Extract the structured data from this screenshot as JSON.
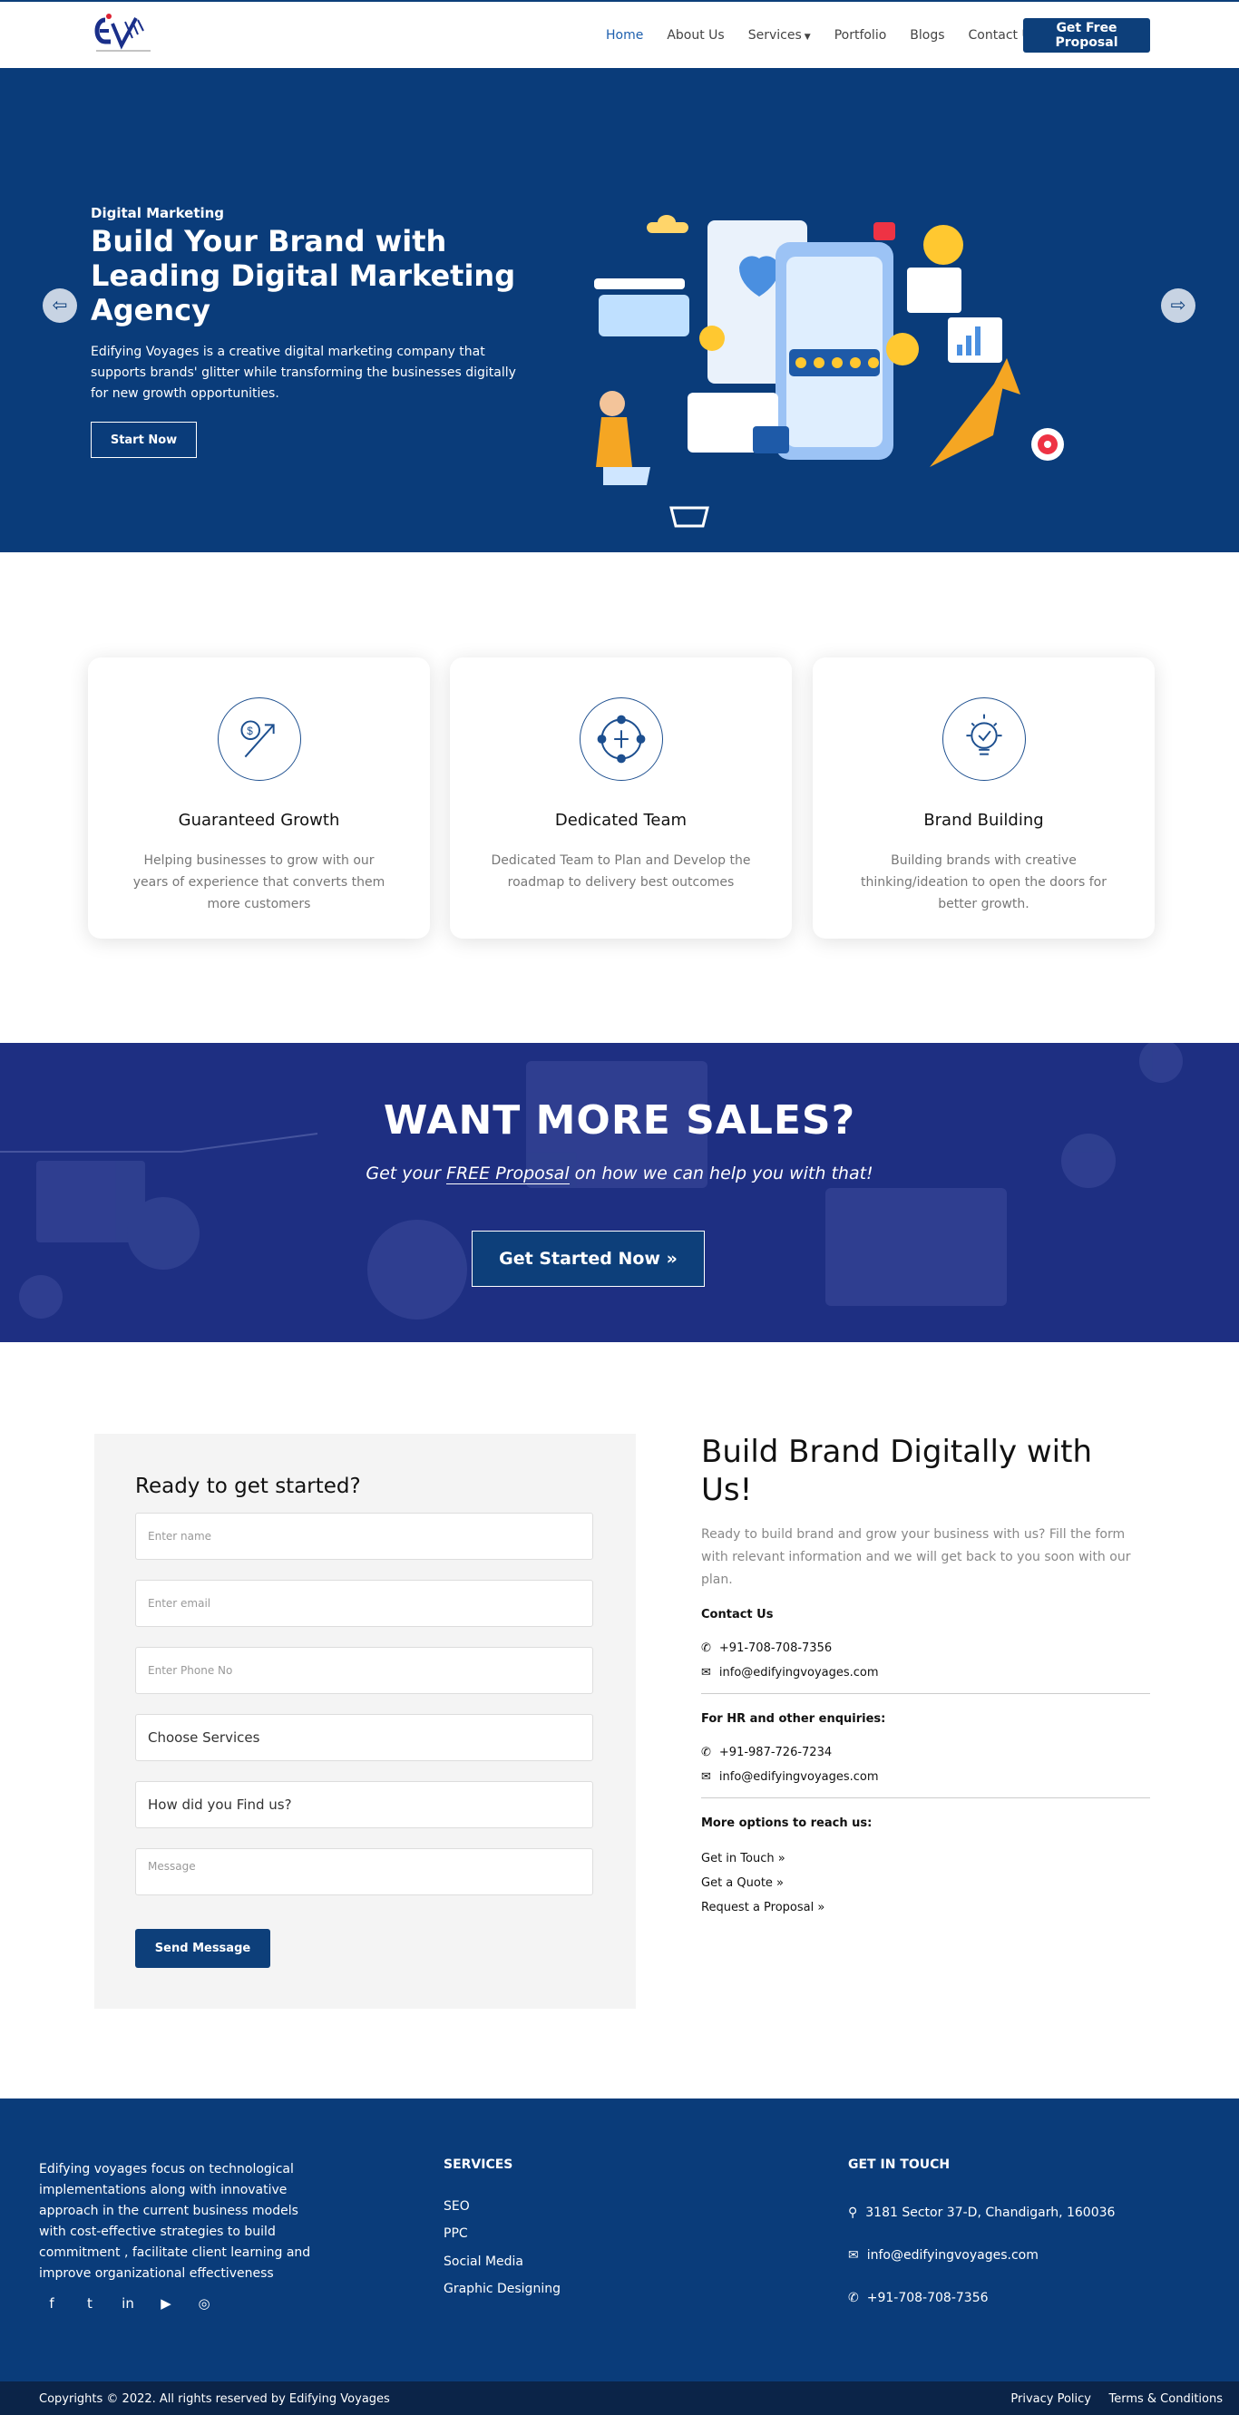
{
  "brand": {
    "logo_icon": "ev-logo-icon",
    "primary": "#0a3c7a",
    "cta_bg": "#1e2f82"
  },
  "nav": {
    "items": [
      {
        "label": "Home",
        "active": true
      },
      {
        "label": "About Us"
      },
      {
        "label": "Services"
      },
      {
        "label": "Portfolio"
      },
      {
        "label": "Blogs"
      },
      {
        "label": "Contact Us"
      }
    ],
    "cta": "Get Free Proposal"
  },
  "hero": {
    "eyebrow": "Digital Marketing",
    "title": "Build Your Brand with Leading Digital Marketing Agency",
    "text": "Edifying Voyages is a creative digital marketing company that supports brands' glitter while transforming the businesses digitally for new growth opportunities.",
    "button": "Start Now",
    "prev_icon": "arrow-left-icon",
    "next_icon": "arrow-right-icon"
  },
  "features": [
    {
      "title": "Guaranteed Growth",
      "text": "Helping businesses to grow with our years of experience that converts them more customers",
      "icon": "growth-icon"
    },
    {
      "title": "Dedicated Team",
      "text": "Dedicated Team to Plan and Develop the roadmap to delivery best outcomes",
      "icon": "team-icon"
    },
    {
      "title": "Brand Building",
      "text": "Building brands with creative thinking/ideation to open the doors for better growth.",
      "icon": "lightbulb-icon"
    }
  ],
  "cta": {
    "title": "WANT MORE SALES?",
    "sub_pre": "Get your ",
    "sub_link": "FREE Proposal",
    "sub_post": " on how we can help you with that!",
    "button": "Get Started Now »"
  },
  "form": {
    "title": "Ready to get started?",
    "name_ph": "Enter name",
    "email_ph": "Enter email",
    "phone_ph": "Enter Phone No",
    "services": "Choose Services",
    "found": "How did you Find us?",
    "message_ph": "Message",
    "submit": "Send Message"
  },
  "contact": {
    "title": "Build Brand Digitally with Us!",
    "lead": "Ready to build brand and grow your business with us? Fill the form with relevant information and we will get back to you soon with our plan.",
    "contact_heading": "Contact Us",
    "phone1": "+91-708-708-7356",
    "email1": "info@edifyingvoyages.com",
    "hr_heading": "For HR and other enquiries:",
    "phone2": "+91-987-726-7234",
    "email2": "info@edifyingvoyages.com",
    "more_heading": "More options to reach us:",
    "links": [
      "Get in Touch »",
      "Get a Quote »",
      "Request a Proposal »"
    ]
  },
  "footer": {
    "about": "Edifying voyages focus on technological implementations along with innovative approach in the current business models with cost-effective strategies to build commitment , facilitate client learning and improve organizational effectiveness",
    "services_heading": "SERVICES",
    "services": [
      "SEO",
      "PPC",
      "Social Media",
      "Graphic Designing"
    ],
    "touch_heading": "GET IN TOUCH",
    "address": "3181 Sector 37-D, Chandigarh, 160036",
    "email": "info@edifyingvoyages.com",
    "phone": "+91-708-708-7356",
    "socials": [
      "facebook-icon",
      "twitter-icon",
      "linkedin-icon",
      "youtube-icon",
      "instagram-icon"
    ],
    "copyright": "Copyrights © 2022. All rights reserved by Edifying Voyages",
    "privacy": "Privacy Policy",
    "terms": "Terms & Conditions"
  }
}
